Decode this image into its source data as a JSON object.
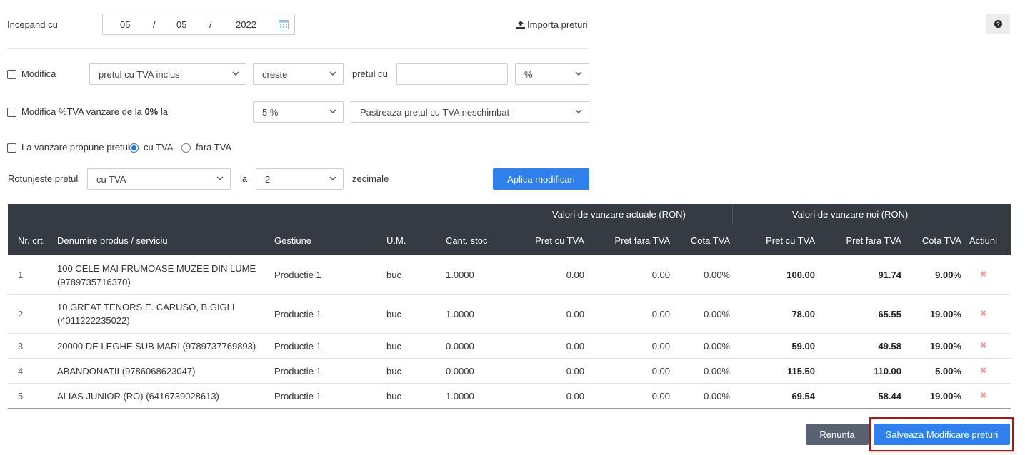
{
  "header": {
    "start_label": "Incepand cu",
    "date": {
      "day": "05",
      "sep1": "/",
      "month": "05",
      "sep2": "/",
      "year": "2022"
    },
    "import_label": "Importa preturi",
    "help_icon": "question-circle-icon"
  },
  "modifica": {
    "label": "Modifica",
    "price_type": "pretul cu TVA inclus",
    "direction": "creste",
    "pret_label": "pretul cu",
    "value": "",
    "unit": "%"
  },
  "tva": {
    "label_prefix": "Modifica %TVA vanzare de la ",
    "from": "0%",
    "label_suffix": " la",
    "to": "5 %",
    "mode": "Pastreaza pretul cu TVA neschimbat"
  },
  "propune": {
    "label": "La vanzare propune pretul",
    "opt1": "cu TVA",
    "opt2": "fara TVA",
    "selected": "cu TVA"
  },
  "rotunjire": {
    "label": "Rotunjeste pretul",
    "mode": "cu TVA",
    "la_label": "la",
    "decimals": "2",
    "suffix": "zecimale",
    "apply_label": "Aplica modificari"
  },
  "table": {
    "group_actual": "Valori de vanzare actuale (RON)",
    "group_new": "Valori de vanzare noi (RON)",
    "columns": [
      "Nr. crt.",
      "Denumire produs / serviciu",
      "Gestiune",
      "U.M.",
      "Cant. stoc",
      "Pret cu TVA",
      "Pret fara TVA",
      "Cota TVA",
      "Pret cu TVA",
      "Pret fara TVA",
      "Cota TVA",
      "Actiuni"
    ],
    "rows": [
      {
        "nr": "1",
        "name1": "100 CELE MAI FRUMOASE MUZEE DIN LUME",
        "name2": "(9789735716370)",
        "gest": "Productie 1",
        "um": "buc",
        "stoc": "1.0000",
        "a_cu": "0.00",
        "a_fara": "0.00",
        "a_cota": "0.00%",
        "n_cu": "100.00",
        "n_fara": "91.74",
        "n_cota": "9.00%"
      },
      {
        "nr": "2",
        "name1": "10 GREAT TENORS E. CARUSO, B.GIGLI",
        "name2": "(4011222235022)",
        "gest": "Productie 1",
        "um": "buc",
        "stoc": "1.0000",
        "a_cu": "0.00",
        "a_fara": "0.00",
        "a_cota": "0.00%",
        "n_cu": "78.00",
        "n_fara": "65.55",
        "n_cota": "19.00%"
      },
      {
        "nr": "3",
        "name1": "20000 DE LEGHE SUB MARI (9789737769893)",
        "name2": "",
        "gest": "Productie 1",
        "um": "buc",
        "stoc": "0.0000",
        "a_cu": "0.00",
        "a_fara": "0.00",
        "a_cota": "0.00%",
        "n_cu": "59.00",
        "n_fara": "49.58",
        "n_cota": "19.00%"
      },
      {
        "nr": "4",
        "name1": "ABANDONATII (9786068623047)",
        "name2": "",
        "gest": "Productie 1",
        "um": "buc",
        "stoc": "0.0000",
        "a_cu": "0.00",
        "a_fara": "0.00",
        "a_cota": "0.00%",
        "n_cu": "115.50",
        "n_fara": "110.00",
        "n_cota": "5.00%"
      },
      {
        "nr": "5",
        "name1": "ALIAS JUNIOR (RO) (6416739028613)",
        "name2": "",
        "gest": "Productie 1",
        "um": "buc",
        "stoc": "1.0000",
        "a_cu": "0.00",
        "a_fara": "0.00",
        "a_cota": "0.00%",
        "n_cu": "69.54",
        "n_fara": "58.44",
        "n_cota": "19.00%"
      }
    ]
  },
  "footer": {
    "cancel_label": "Renunta",
    "save_label": "Salveaza Modificare preturi"
  },
  "colors": {
    "accent": "#2f80ed",
    "table_header": "#363a42",
    "highlight_border": "#e00000",
    "delete_icon": "#f0a0a0"
  }
}
